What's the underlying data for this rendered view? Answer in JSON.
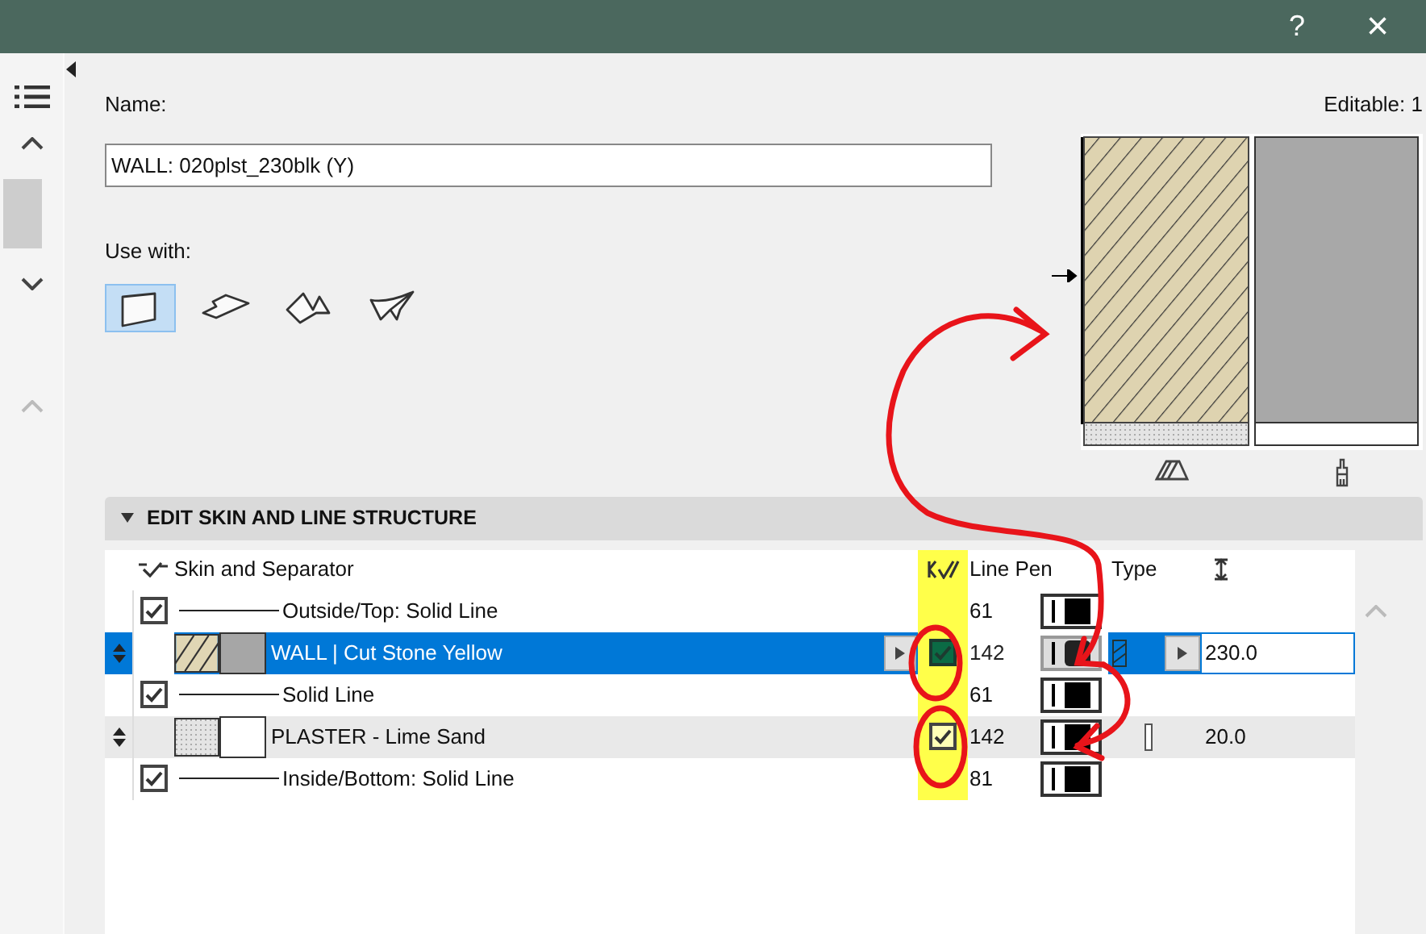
{
  "window": {
    "help": "?",
    "close": "×"
  },
  "name": {
    "label": "Name:",
    "value": "WALL: 020plst_230blk (Y)"
  },
  "editable": "Editable: 1",
  "use_with": {
    "label": "Use with:",
    "options": [
      {
        "kind": "wall",
        "selected": true
      },
      {
        "kind": "slab",
        "selected": false
      },
      {
        "kind": "roof",
        "selected": false
      },
      {
        "kind": "shell",
        "selected": false
      }
    ]
  },
  "section": {
    "title": "EDIT SKIN AND LINE STRUCTURE",
    "expanded": true
  },
  "table": {
    "columns": [
      "Skin and Separator",
      "Line Pen",
      "Type"
    ],
    "rows": [
      {
        "kind": "separator",
        "checked": true,
        "label": "Outside/Top: Solid Line",
        "pen": "61"
      },
      {
        "kind": "skin",
        "selected": true,
        "swatch": {
          "kind": "hatch"
        },
        "label": "WALL | Cut Stone Yellow",
        "core": true,
        "pen": "142",
        "thickness": "230.0"
      },
      {
        "kind": "separator",
        "checked": true,
        "label": "Solid Line",
        "pen": "61"
      },
      {
        "kind": "skin",
        "selected": false,
        "swatch": {
          "kind": "dots"
        },
        "label": "PLASTER - Lime Sand",
        "core": true,
        "pen": "142",
        "thickness": "20.0"
      },
      {
        "kind": "separator",
        "checked": true,
        "label": "Inside/Bottom: Solid Line",
        "pen": "81"
      }
    ]
  }
}
